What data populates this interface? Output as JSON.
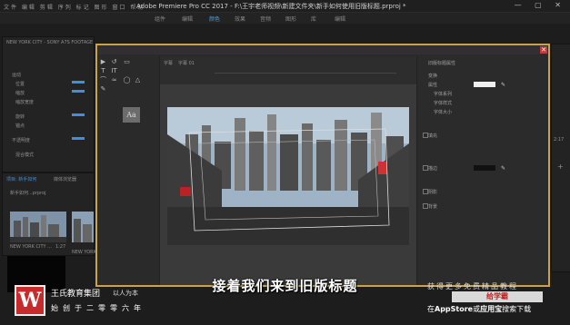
{
  "app": {
    "title": "Adobe Premiere Pro CC 2017 - F:\\王宇老师视频\\新建文件夹\\新手如何使用旧版标题.prproj *",
    "menu": "文件  编辑  剪辑  序列  标记  图形  窗口  帮助",
    "window_buttons": "— ▢ ✕"
  },
  "workspaces": [
    "组件",
    "编辑",
    "颜色",
    "效果",
    "音频",
    "图形",
    "库",
    "编辑"
  ],
  "workspace_active_index": 2,
  "left_panel": {
    "source_label": "NEW YORK CITY - SONY A7S FOOTAGE",
    "effect_rows": [
      "运动",
      "位置",
      "缩放",
      "缩放宽度",
      "旋转",
      "锚点",
      "不透明度",
      "混合模式"
    ],
    "project_tab": "项目: 新手如何",
    "media_tab": "媒体浏览器",
    "project_file": "新手如何...prproj",
    "clip1": "NEW YORK CITY ...",
    "clip1_time": "1:27",
    "clip2": "NEW YORK CITY - ..."
  },
  "dialog": {
    "tab_title": "字幕",
    "tab_style": "字幕 01",
    "close_glyph": "✕",
    "aa_label": "Aa",
    "properties_header": "旧版标题属性",
    "properties": [
      "变换",
      "属性",
      "字体系列",
      "字体样式",
      "字体大小",
      "填充",
      "描边",
      "阴影",
      "背景"
    ],
    "tools": [
      "▶",
      "↺",
      "T",
      "IT",
      "⌒",
      "≈",
      "✎",
      "▭",
      "◯",
      "△"
    ]
  },
  "subtitle": "接着我们来到旧版标题",
  "brand": {
    "logo": "W",
    "name": "王氏教育集团",
    "slogan": "以人为本",
    "line2": "始创于二零零六年"
  },
  "promo": {
    "line1": "获得更多免费精品教程",
    "badge": "给学霸",
    "line2_prefix": "在",
    "line2_appstore": "AppStore",
    "line2_mid": "或",
    "line2_app": "应用宝",
    "line2_suffix": "搜索下载"
  },
  "timecode": "2:17",
  "colors": {
    "dialog_border": "#c9a24a",
    "accent_blue": "#3f8fe0",
    "brand_red": "#c72b2b",
    "badge_red": "#c81e1e"
  }
}
